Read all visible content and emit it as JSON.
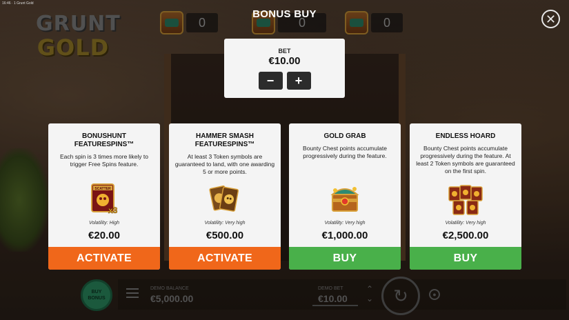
{
  "window": {
    "title": "16:46 · 1 Grunt Gold"
  },
  "logo": {
    "line1": "GRUNT",
    "line2": "GOLD"
  },
  "counters": [
    {
      "icon": "chest-icon",
      "value": "0"
    },
    {
      "icon": "chest-icon",
      "value": "0"
    },
    {
      "icon": "chest-icon",
      "value": "0"
    }
  ],
  "modal": {
    "title": "BONUS BUY",
    "close_icon": "close-icon",
    "bet": {
      "label": "BET",
      "value": "€10.00",
      "minus": "−",
      "plus": "+"
    }
  },
  "options": [
    {
      "name": "BONUSHUNT FEATURESPINS™",
      "description": "Each spin is 3 times more likely to trigger Free Spins feature.",
      "art": "scatter-x3-icon",
      "art_text": "SCATTER",
      "art_mult": "x3",
      "volatility": "Volatility: High",
      "price": "€20.00",
      "action": "ACTIVATE",
      "action_color": "#f0671a"
    },
    {
      "name": "HAMMER SMASH FEATURESPINS™",
      "description": "At least 3 Token symbols are guaranteed to land, with one awarding 5 or more points.",
      "art": "token-cards-icon",
      "volatility": "Volatility: Very high",
      "price": "€500.00",
      "action": "ACTIVATE",
      "action_color": "#f0671a"
    },
    {
      "name": "GOLD GRAB",
      "description": "Bounty Chest points accumulate progressively during the feature.",
      "art": "treasure-chest-icon",
      "volatility": "Volatility: Very high",
      "price": "€1,000.00",
      "action": "BUY",
      "action_color": "#49b04a"
    },
    {
      "name": "ENDLESS HOARD",
      "description": "Bounty Chest points accumulate progressively during the feature. At least 2 Token symbols are guaranteed on the first spin.",
      "art": "token-stack-icon",
      "volatility": "Volatility: Very high",
      "price": "€2,500.00",
      "action": "BUY",
      "action_color": "#49b04a"
    }
  ],
  "hud": {
    "buy_bonus": "BUY BONUS",
    "balance_label": "DEMO BALANCE",
    "balance_value": "€5,000.00",
    "bet_label": "DEMO BET",
    "bet_value": "€10.00"
  }
}
